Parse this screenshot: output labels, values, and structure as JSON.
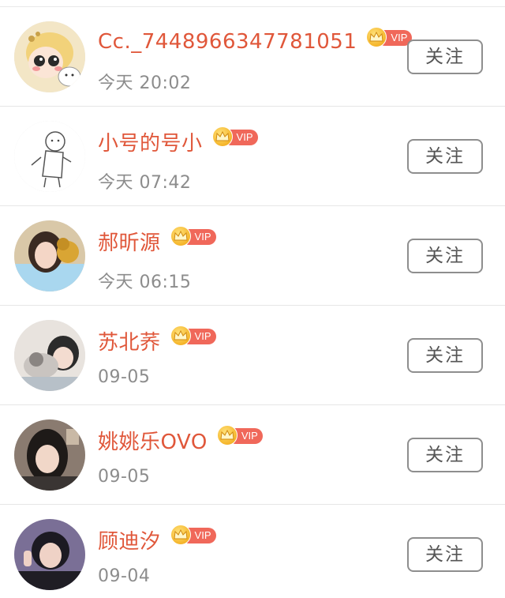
{
  "users": [
    {
      "name": "Cc._7448966347781051",
      "time": "今天 20:02",
      "badge": "VIP",
      "follow_label": "关注",
      "avatar": "cartoon-girl-avatar"
    },
    {
      "name": "小号的号小",
      "time": "今天 07:42",
      "badge": "VIP",
      "follow_label": "关注",
      "avatar": "sketch-doodle-avatar"
    },
    {
      "name": "郝昕源",
      "time": "今天 06:15",
      "badge": "VIP",
      "follow_label": "关注",
      "avatar": "photo-avatar"
    },
    {
      "name": "苏北荞",
      "time": "09-05",
      "badge": "VIP",
      "follow_label": "关注",
      "avatar": "photo-avatar"
    },
    {
      "name": "姚姚乐OVO",
      "time": "09-05",
      "badge": "VIP",
      "follow_label": "关注",
      "avatar": "photo-avatar"
    },
    {
      "name": "顾迪汐",
      "time": "09-04",
      "badge": "VIP",
      "follow_label": "关注",
      "avatar": "photo-avatar"
    }
  ],
  "colors": {
    "name_accent": "#e0573a",
    "vip_badge": "#f0685a",
    "crown": "#f5b52a",
    "time_text": "#8c8c8c",
    "button_border": "#8e8e8e"
  }
}
